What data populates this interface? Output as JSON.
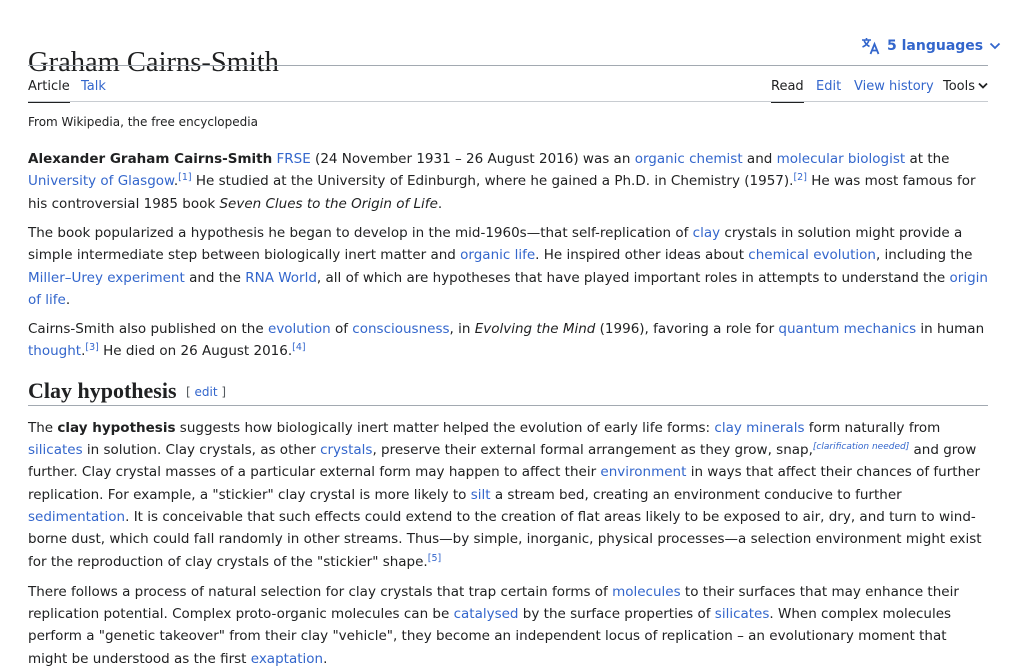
{
  "article": {
    "title": "Graham Cairns-Smith",
    "languages_label": "5 languages",
    "tagline": "From Wikipedia, the free encyclopedia"
  },
  "tabs": {
    "article": "Article",
    "talk": "Talk",
    "read": "Read",
    "edit": "Edit",
    "view_history": "View history",
    "tools": "Tools"
  },
  "intro": {
    "p1": {
      "name_bold": "Alexander Graham Cairns-Smith",
      "frse": "FRSE",
      "t1": " (24 November 1931 – 26 August 2016) was an ",
      "organic_chemist": "organic chemist",
      "t2": " and ",
      "molecular_biologist": "molecular biologist",
      "t3": " at the ",
      "university": "University of Glasgow",
      "t4": ".",
      "ref1": "[1]",
      "t5": " He studied at the University of Edinburgh, where he gained a Ph.D. in Chemistry (1957).",
      "ref2": "[2]",
      "t6": " He was most famous for his controversial 1985 book ",
      "book": "Seven Clues to the Origin of Life",
      "t7": "."
    },
    "p2": {
      "t1": "The book popularized a hypothesis he began to develop in the mid-1960s—that self-replication of ",
      "clay": "clay",
      "t2": " crystals in solution might provide a simple intermediate step between biologically inert matter and ",
      "organic_life": "organic life",
      "t3": ". He inspired other ideas about ",
      "chemical_evolution": "chemical evolution",
      "t4": ", including the ",
      "miller_urey": "Miller–Urey experiment",
      "t5": " and the ",
      "rna_world": "RNA World",
      "t6": ", all of which are hypotheses that have played important roles in attempts to understand the ",
      "origin_of_life": "origin of life",
      "t7": "."
    },
    "p3": {
      "t1": "Cairns-Smith also published on the ",
      "evolution": "evolution",
      "t2": " of ",
      "consciousness": "consciousness",
      "t3": ", in ",
      "evolving_mind": "Evolving the Mind",
      "t4": " (1996), favoring a role for ",
      "quantum_mechanics": "quantum mechanics",
      "t5": " in human ",
      "thought": "thought",
      "t6": ".",
      "ref3": "[3]",
      "t7": " He died on 26 August 2016.",
      "ref4": "[4]"
    }
  },
  "section": {
    "heading": "Clay hypothesis",
    "edit_open": "[ ",
    "edit_label": "edit",
    "edit_close": " ]",
    "p1": {
      "t1": "The ",
      "bold": "clay hypothesis",
      "t2": " suggests how biologically inert matter helped the evolution of early life forms: ",
      "clay_minerals": "clay minerals",
      "t3": " form naturally from ",
      "silicates": "silicates",
      "t4": " in solution. Clay crystals, as other ",
      "crystals": "crystals",
      "t5": ", preserve their external formal arrangement as they grow, snap,",
      "clarification": "[clarification needed]",
      "t6": " and grow further. Clay crystal masses of a particular external form may happen to affect their ",
      "environment": "environment",
      "t7": " in ways that affect their chances of further replication. For example, a \"stickier\" clay crystal is more likely to ",
      "silt": "silt",
      "t8": " a stream bed, creating an environment conducive to further ",
      "sedimentation": "sedimentation",
      "t9": ". It is conceivable that such effects could extend to the creation of flat areas likely to be exposed to air, dry, and turn to wind-borne dust, which could fall randomly in other streams. Thus—by simple, inorganic, physical processes—a selection environment might exist for the reproduction of clay crystals of the \"stickier\" shape.",
      "ref5": "[5]"
    },
    "p2": {
      "t1": "There follows a process of natural selection for clay crystals that trap certain forms of ",
      "molecules": "molecules",
      "t2": " to their surfaces that may enhance their replication potential. Complex proto-organic molecules can be ",
      "catalysed": "catalysed",
      "t3": " by the surface properties of ",
      "silicates": "silicates",
      "t4": ". When complex molecules perform a \"genetic takeover\" from their clay \"vehicle\", they become an independent locus of replication – an evolutionary moment that might be understood as the first ",
      "exaptation": "exaptation",
      "t5": "."
    }
  },
  "colors": {
    "link": "#3366cc",
    "text": "#202122",
    "rule": "#a2a9b1"
  }
}
